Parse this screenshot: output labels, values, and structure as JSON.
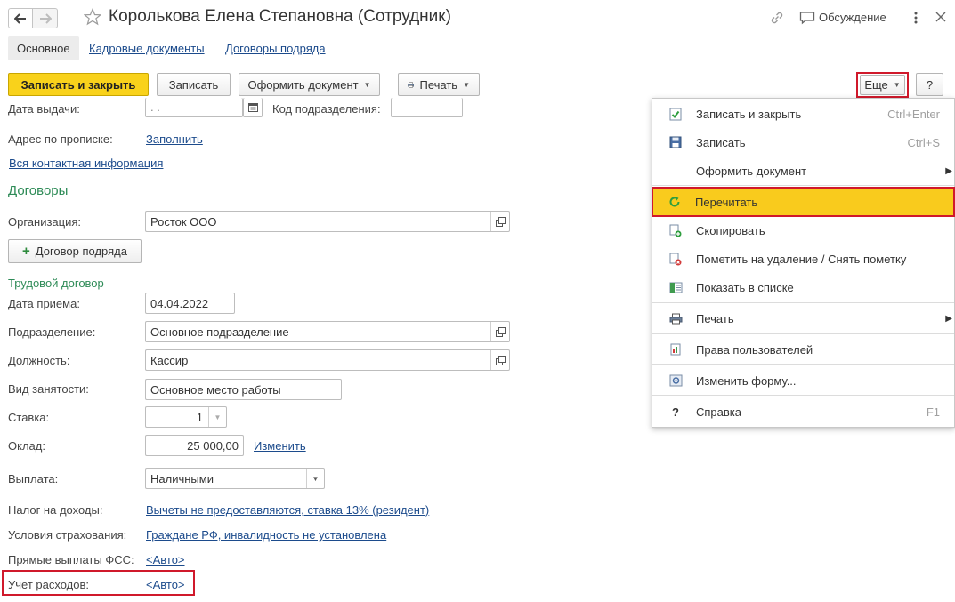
{
  "window": {
    "title": "Королькова Елена Степановна (Сотрудник)",
    "discussion_label": "Обсуждение"
  },
  "tabs": [
    {
      "label": "Основное"
    },
    {
      "label": "Кадровые документы"
    },
    {
      "label": "Договоры подряда"
    }
  ],
  "toolbar": {
    "save_close": "Записать и закрыть",
    "save": "Записать",
    "create_doc": "Оформить документ",
    "print": "Печать",
    "more": "Еще",
    "help": "?"
  },
  "form": {
    "issue_date_label": "Дата выдачи:",
    "issue_date_value": ". .",
    "dept_code_label": "Код подразделения:",
    "address_label": "Адрес по прописке:",
    "address_link": "Заполнить",
    "all_contacts_link": "Вся контактная информация",
    "contracts_heading": "Договоры",
    "org_label": "Организация:",
    "org_value": "Росток ООО",
    "contract_button": "Договор подряда",
    "labor_contract_heading": "Трудовой договор",
    "hire_date_label": "Дата приема:",
    "hire_date_value": "04.04.2022",
    "division_label": "Подразделение:",
    "division_value": "Основное подразделение",
    "position_label": "Должность:",
    "position_value": "Кассир",
    "employment_label": "Вид занятости:",
    "employment_value": "Основное место работы",
    "rate_label": "Ставка:",
    "rate_value": "1",
    "salary_label": "Оклад:",
    "salary_value": "25 000,00",
    "salary_change_link": "Изменить",
    "payment_label": "Выплата:",
    "payment_value": "Наличными",
    "tax_label": "Налог на доходы:",
    "tax_link": "Вычеты не предоставляются, ставка 13% (резидент)",
    "insurance_label": "Условия страхования:",
    "insurance_link": "Граждане РФ, инвалидность не установлена",
    "fss_label": "Прямые выплаты ФСС:",
    "fss_link": "<Авто>",
    "expense_label": "Учет расходов:",
    "expense_link": "<Авто>"
  },
  "menu": {
    "items": [
      {
        "label": "Записать и закрыть",
        "shortcut": "Ctrl+Enter",
        "icon": "save-close-icon"
      },
      {
        "label": "Записать",
        "shortcut": "Ctrl+S",
        "icon": "floppy-icon"
      },
      {
        "label": "Оформить документ",
        "shortcut": "",
        "icon": ""
      },
      {
        "label": "Перечитать",
        "shortcut": "",
        "icon": "refresh-icon"
      },
      {
        "label": "Скопировать",
        "shortcut": "",
        "icon": "copy-icon"
      },
      {
        "label": "Пометить на удаление / Снять пометку",
        "shortcut": "",
        "icon": "mark-delete-icon"
      },
      {
        "label": "Показать в списке",
        "shortcut": "",
        "icon": "show-in-list-icon"
      },
      {
        "label": "Печать",
        "shortcut": "",
        "icon": "printer-icon"
      },
      {
        "label": "Права пользователей",
        "shortcut": "",
        "icon": "user-rights-icon"
      },
      {
        "label": "Изменить форму...",
        "shortcut": "",
        "icon": "change-form-icon"
      },
      {
        "label": "Справка",
        "shortcut": "F1",
        "icon": "help-icon"
      }
    ]
  },
  "colors": {
    "primary_button": "#f9d21b",
    "highlight_item": "#f9cb1d",
    "annotation_red": "#d0192b",
    "link": "#1c4b8c",
    "section_heading": "#2e8b57"
  }
}
